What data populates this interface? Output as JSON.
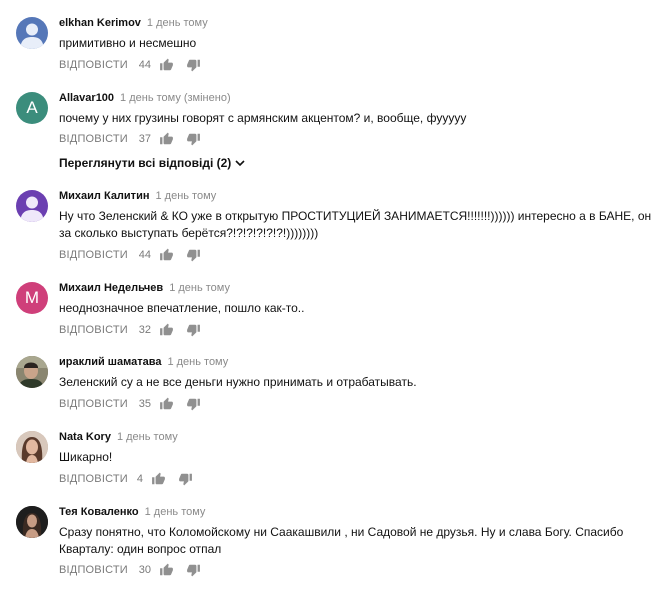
{
  "comments": [
    {
      "author": "elkhan Kerimov",
      "time": "1 день тому",
      "edited": "",
      "text": "примитивно и несмешно",
      "reply": "ВІДПОВІСТИ",
      "likes": "44",
      "avatar_letter": "",
      "avatar_color": "#5577b8",
      "avatar_type": "person-icon"
    },
    {
      "author": "Allavar100",
      "time": "1 день тому",
      "edited": "(змінено)",
      "text": "почему у них грузины говорят с армянским акцентом?  и, вообще, фууууу",
      "reply": "ВІДПОВІСТИ",
      "likes": "37",
      "avatar_letter": "A",
      "avatar_color": "#3b8d7c",
      "avatar_type": "letter"
    },
    {
      "author": "Михаил Калитин",
      "time": "1 день тому",
      "edited": "",
      "text": "Ну что Зеленский & КО уже в открытую ПРОСТИТУЦИЕЙ ЗАНИМАЕТСЯ!!!!!!!))))))  интересно а в БАНЕ, он за сколько выступать берётся?!?!?!?!?!?!))))))))",
      "reply": "ВІДПОВІСТИ",
      "likes": "44",
      "avatar_letter": "",
      "avatar_color": "#6b3fb1",
      "avatar_type": "person-icon"
    },
    {
      "author": "Михаил Недельчев",
      "time": "1 день тому",
      "edited": "",
      "text": "неоднозначное впечатление, пошло как-то..",
      "reply": "ВІДПОВІСТИ",
      "likes": "32",
      "avatar_letter": "M",
      "avatar_color": "#cf3f7a",
      "avatar_type": "letter"
    },
    {
      "author": "ираклий шаматава",
      "time": "1 день тому",
      "edited": "",
      "text": "Зеленский су  а не все деньги нужно принимать и отрабатывать.",
      "reply": "ВІДПОВІСТИ",
      "likes": "35",
      "avatar_letter": "",
      "avatar_color": "#6d6a55",
      "avatar_type": "photo-man"
    },
    {
      "author": "Nata Kory",
      "time": "1 день тому",
      "edited": "",
      "text": "Шикарно!",
      "reply": "ВІДПОВІСТИ",
      "likes": "4",
      "avatar_letter": "",
      "avatar_color": "#b89a86",
      "avatar_type": "photo-woman"
    },
    {
      "author": "Тея Коваленко",
      "time": "1 день тому",
      "edited": "",
      "text": "Сразу понятно, что Коломойскому ни Саакашвили , ни Садовой не друзья. Ну и слава Богу. Спасибо Кварталу: один вопрос отпал",
      "reply": "ВІДПОВІСТИ",
      "likes": "30",
      "avatar_letter": "",
      "avatar_color": "#2b2b2b",
      "avatar_type": "photo-dark"
    }
  ],
  "replies_link": {
    "label": "Переглянути всі відповіді (2)"
  },
  "colors": {
    "text": "#111111",
    "secondary": "#7a7a7a",
    "icon": "#909090"
  }
}
